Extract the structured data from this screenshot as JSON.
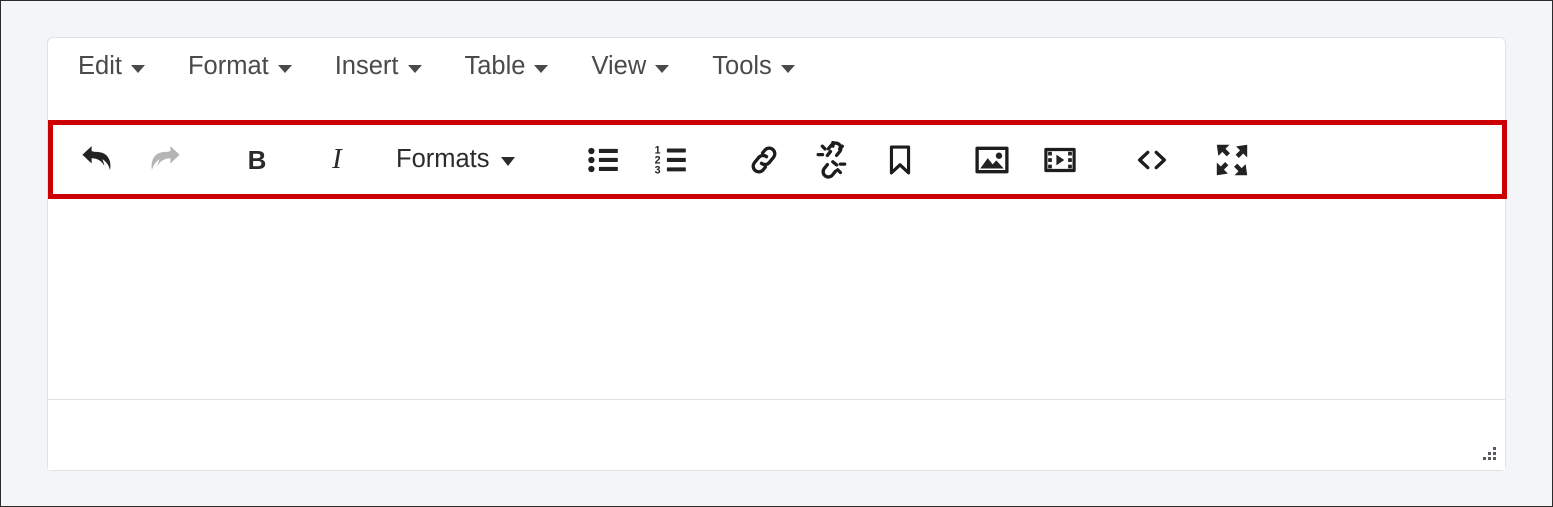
{
  "editor": {
    "menubar": {
      "items": [
        {
          "label": "Edit",
          "name": "menu-edit"
        },
        {
          "label": "Format",
          "name": "menu-format"
        },
        {
          "label": "Insert",
          "name": "menu-insert"
        },
        {
          "label": "Table",
          "name": "menu-table"
        },
        {
          "label": "View",
          "name": "menu-view"
        },
        {
          "label": "Tools",
          "name": "menu-tools"
        }
      ]
    },
    "toolbar": {
      "highlighted": true,
      "highlight_color": "#cc0000",
      "formats_label": "Formats",
      "bold_label": "B",
      "italic_label": "I",
      "buttons": [
        {
          "name": "undo-icon",
          "title": "Undo",
          "state": "enabled"
        },
        {
          "name": "redo-icon",
          "title": "Redo",
          "state": "disabled"
        },
        {
          "name": "bold-icon",
          "title": "Bold",
          "state": "enabled"
        },
        {
          "name": "italic-icon",
          "title": "Italic",
          "state": "enabled"
        },
        {
          "name": "formats-dropdown",
          "title": "Formats",
          "state": "enabled"
        },
        {
          "name": "bullet-list-icon",
          "title": "Bullet list",
          "state": "enabled"
        },
        {
          "name": "numbered-list-icon",
          "title": "Numbered list",
          "state": "enabled"
        },
        {
          "name": "link-icon",
          "title": "Insert/edit link",
          "state": "enabled"
        },
        {
          "name": "unlink-icon",
          "title": "Remove link",
          "state": "enabled"
        },
        {
          "name": "bookmark-icon",
          "title": "Anchor",
          "state": "enabled"
        },
        {
          "name": "image-icon",
          "title": "Insert/edit image",
          "state": "enabled"
        },
        {
          "name": "media-icon",
          "title": "Insert/edit media",
          "state": "enabled"
        },
        {
          "name": "source-code-icon",
          "title": "Source code",
          "state": "enabled"
        },
        {
          "name": "fullscreen-icon",
          "title": "Fullscreen",
          "state": "enabled"
        }
      ]
    },
    "content": {
      "value": "",
      "placeholder": ""
    },
    "statusbar": {
      "text": "",
      "resize_handle": "resize-grip"
    }
  },
  "colors": {
    "page_background": "#f4f5f7",
    "editor_background": "#ffffff",
    "border": "#dfe1e5",
    "highlight": "#cc0000",
    "menu_text": "#4a4a4a",
    "icon": "#222222",
    "icon_disabled": "#b5b5b5"
  }
}
